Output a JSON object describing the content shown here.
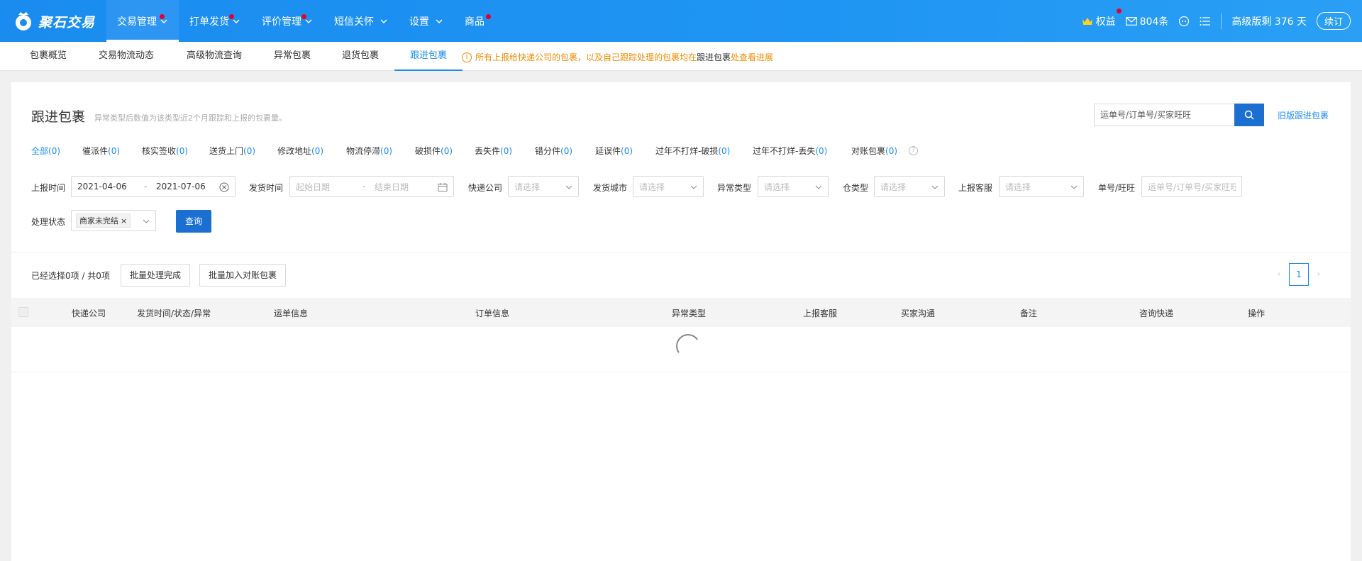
{
  "app": {
    "logo_text": "聚石交易",
    "nav": [
      {
        "label": "交易管理",
        "has_dropdown": true,
        "has_dot": true,
        "active": true
      },
      {
        "label": "打单发货",
        "has_dropdown": true,
        "has_dot": true
      },
      {
        "label": "评价管理",
        "has_dropdown": true,
        "has_dot": true
      },
      {
        "label": "短信关怀",
        "has_dropdown": true,
        "has_dot": false
      },
      {
        "label": "设置",
        "has_dropdown": true,
        "has_dot": false
      },
      {
        "label": "商品",
        "has_dropdown": false,
        "has_dot": true
      }
    ],
    "top_right": {
      "benefits_label": "权益",
      "messages_label": "804条",
      "plan_label": "高级版剩 376 天",
      "renew_label": "续订"
    }
  },
  "subnav": {
    "tabs": [
      "包裹概览",
      "交易物流动态",
      "高级物流查询",
      "异常包裹",
      "退货包裹",
      "跟进包裹"
    ],
    "active_index": 5,
    "notice": {
      "part1": "所有上报给快递公司的包裹，以及自己跟踪处理的包裹均在",
      "part2": "跟进包裹",
      "part3": "处查看进展"
    }
  },
  "page": {
    "title": "跟进包裹",
    "subtitle": "异常类型后数值为该类型近2个月跟踪和上报的包裹量。",
    "search_placeholder": "运单号/订单号/买家旺旺",
    "old_link": "旧版跟进包裹"
  },
  "categories": [
    {
      "label": "全部",
      "count": "(0)",
      "active": true
    },
    {
      "label": "催派件",
      "count": "(0)"
    },
    {
      "label": "核实签收",
      "count": "(0)"
    },
    {
      "label": "送货上门",
      "count": "(0)"
    },
    {
      "label": "修改地址",
      "count": "(0)"
    },
    {
      "label": "物流停滞",
      "count": "(0)"
    },
    {
      "label": "破损件",
      "count": "(0)"
    },
    {
      "label": "丢失件",
      "count": "(0)"
    },
    {
      "label": "错分件",
      "count": "(0)"
    },
    {
      "label": "延误件",
      "count": "(0)"
    },
    {
      "label": "过年不打烊-破损",
      "count": "(0)"
    },
    {
      "label": "过年不打烊-丢失",
      "count": "(0)"
    },
    {
      "label": "对账包裹",
      "count": "(0)"
    }
  ],
  "filters": {
    "report_time_label": "上报时间",
    "report_start": "2021-04-06",
    "report_end": "2021-07-06",
    "ship_time_label": "发货时间",
    "ship_start_placeholder": "起始日期",
    "ship_end_placeholder": "结束日期",
    "courier_label": "快递公司",
    "city_label": "发货城市",
    "abnormal_label": "异常类型",
    "warehouse_label": "仓类型",
    "service_label": "上报客服",
    "order_label": "单号/旺旺",
    "select_placeholder": "请选择",
    "order_placeholder": "运单号/订单号/买家旺旺",
    "status_label": "处理状态",
    "status_value": "商家未完结",
    "query_btn": "查询",
    "date_dash": "-"
  },
  "actions": {
    "selection_info": "已经选择0项 / 共0项",
    "batch_complete": "批量处理完成",
    "batch_add": "批量加入对账包裹",
    "current_page": "1",
    "prev": "‹",
    "next": "›"
  },
  "table": {
    "columns": [
      "快递公司",
      "发货时间/状态/异常",
      "运单信息",
      "订单信息",
      "异常类型",
      "上报客服",
      "买家沟通",
      "备注",
      "咨询快递",
      "操作"
    ]
  },
  "colors": {
    "topbar": "#1a8cf0",
    "accent": "#1a8cf0",
    "primary_button": "#1a6fd0",
    "warning": "#f08c00",
    "badge_dot": "#e4002b"
  }
}
